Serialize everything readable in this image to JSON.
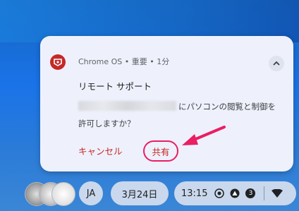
{
  "notification": {
    "source": "Chrome OS",
    "sep1": "•",
    "priority": "重要",
    "sep2": "•",
    "time": "1分",
    "title": "リモート サポート",
    "body_line1": "にパソコンの閲覧と制御を",
    "body_line2": "許可しますか？",
    "cancel_label": "キャンセル",
    "share_label": "共有"
  },
  "shelf": {
    "ime": "JA",
    "date": "3月24日",
    "time": "13:15",
    "badge_count": "3"
  },
  "colors": {
    "accent_red": "#c62828",
    "highlight_pink": "#e91e63",
    "card_bg": "#eef1fb"
  },
  "icons": [
    "chrome-remote-desktop-icon",
    "chevron-up-icon",
    "screen-record-icon",
    "triangle-icon",
    "wifi-icon"
  ]
}
